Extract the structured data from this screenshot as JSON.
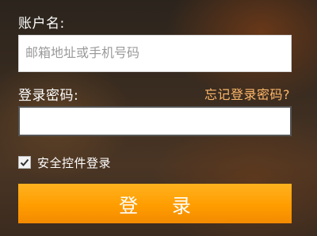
{
  "form": {
    "account_label": "账户名:",
    "account_placeholder": "邮箱地址或手机号码",
    "account_value": "",
    "password_label": "登录密码:",
    "forgot_password_link": "忘记登录密码?",
    "password_value": "",
    "secure_login_label": "安全控件登录",
    "secure_login_checked": true,
    "submit_label": "登 录"
  },
  "colors": {
    "button_orange": "#ff9d00",
    "link_orange": "#ffb86a"
  }
}
